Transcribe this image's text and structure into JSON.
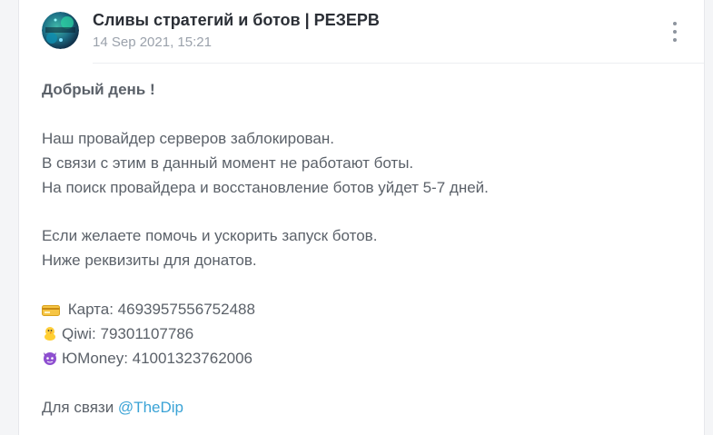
{
  "post": {
    "channel_name": "Сливы стратегий и ботов | РЕЗЕРВ",
    "timestamp": "14 Sep 2021, 15:21",
    "menu_icon": "more-vertical-icon",
    "greeting": "Добрый день !",
    "paragraph1": [
      "Наш провайдер серверов заблокирован.",
      "В связи с этим в данный момент не работают боты.",
      "На поиск провайдера и восстановление ботов уйдет 5-7 дней."
    ],
    "paragraph2": [
      "Если желаете помочь и ускорить запуск ботов.",
      "Ниже реквизиты для донатов."
    ],
    "payments": [
      {
        "icon": "credit-card-icon",
        "text": " Карта: 4693957556752488"
      },
      {
        "icon": "chick-icon",
        "text": "Qiwi: 79301107786"
      },
      {
        "icon": "purple-devil-icon",
        "text": "ЮMoney: 41001323762006"
      }
    ],
    "contact_prefix": "Для связи ",
    "contact_link": "@TheDip"
  }
}
